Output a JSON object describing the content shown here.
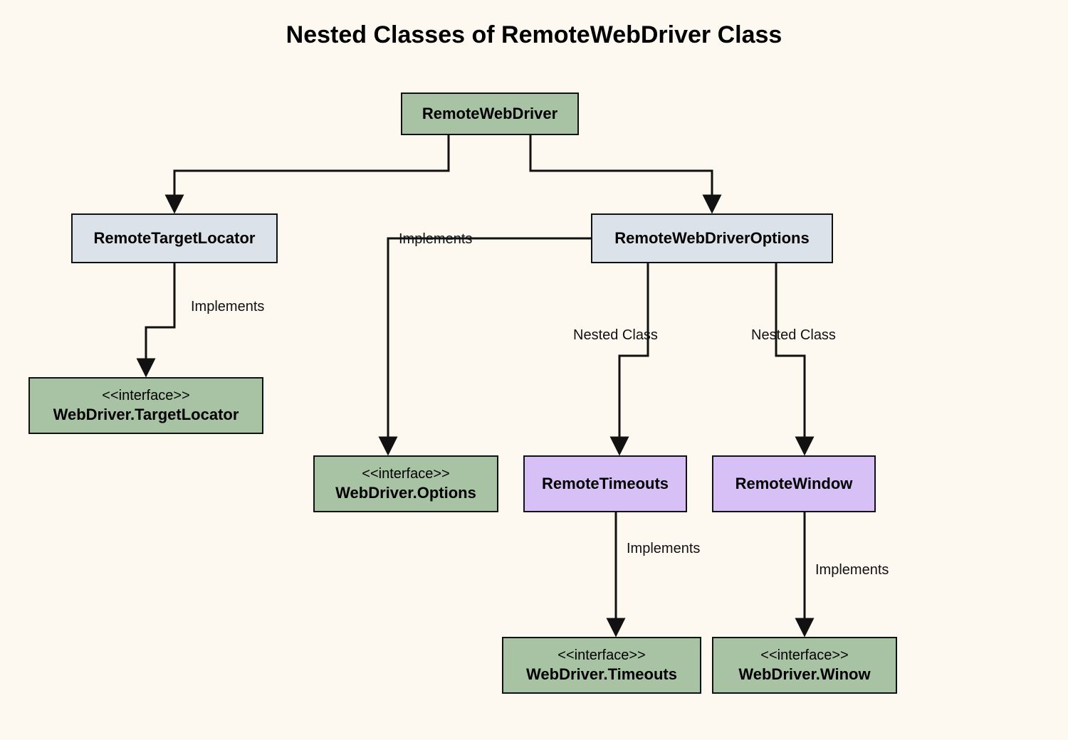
{
  "title": "Nested Classes of RemoteWebDriver Class",
  "nodes": {
    "remoteWebDriver": {
      "name": "RemoteWebDriver"
    },
    "remoteTargetLocator": {
      "name": "RemoteTargetLocator"
    },
    "remoteWebDriverOptions": {
      "name": "RemoteWebDriverOptions"
    },
    "wdTargetLocator": {
      "stereo": "<<interface>>",
      "name": "WebDriver.TargetLocator"
    },
    "wdOptions": {
      "stereo": "<<interface>>",
      "name": "WebDriver.Options"
    },
    "remoteTimeouts": {
      "name": "RemoteTimeouts"
    },
    "remoteWindow": {
      "name": "RemoteWindow"
    },
    "wdTimeouts": {
      "stereo": "<<interface>>",
      "name": "WebDriver.Timeouts"
    },
    "wdWindow": {
      "stereo": "<<interface>>",
      "name": "WebDriver.Winow"
    }
  },
  "edgeLabels": {
    "rtlImplements": "Implements",
    "optionsImplements": "Implements",
    "timeoutsNested": "Nested Class",
    "windowNested": "Nested Class",
    "timeoutsImplements": "Implements",
    "windowImplements": "Implements"
  }
}
